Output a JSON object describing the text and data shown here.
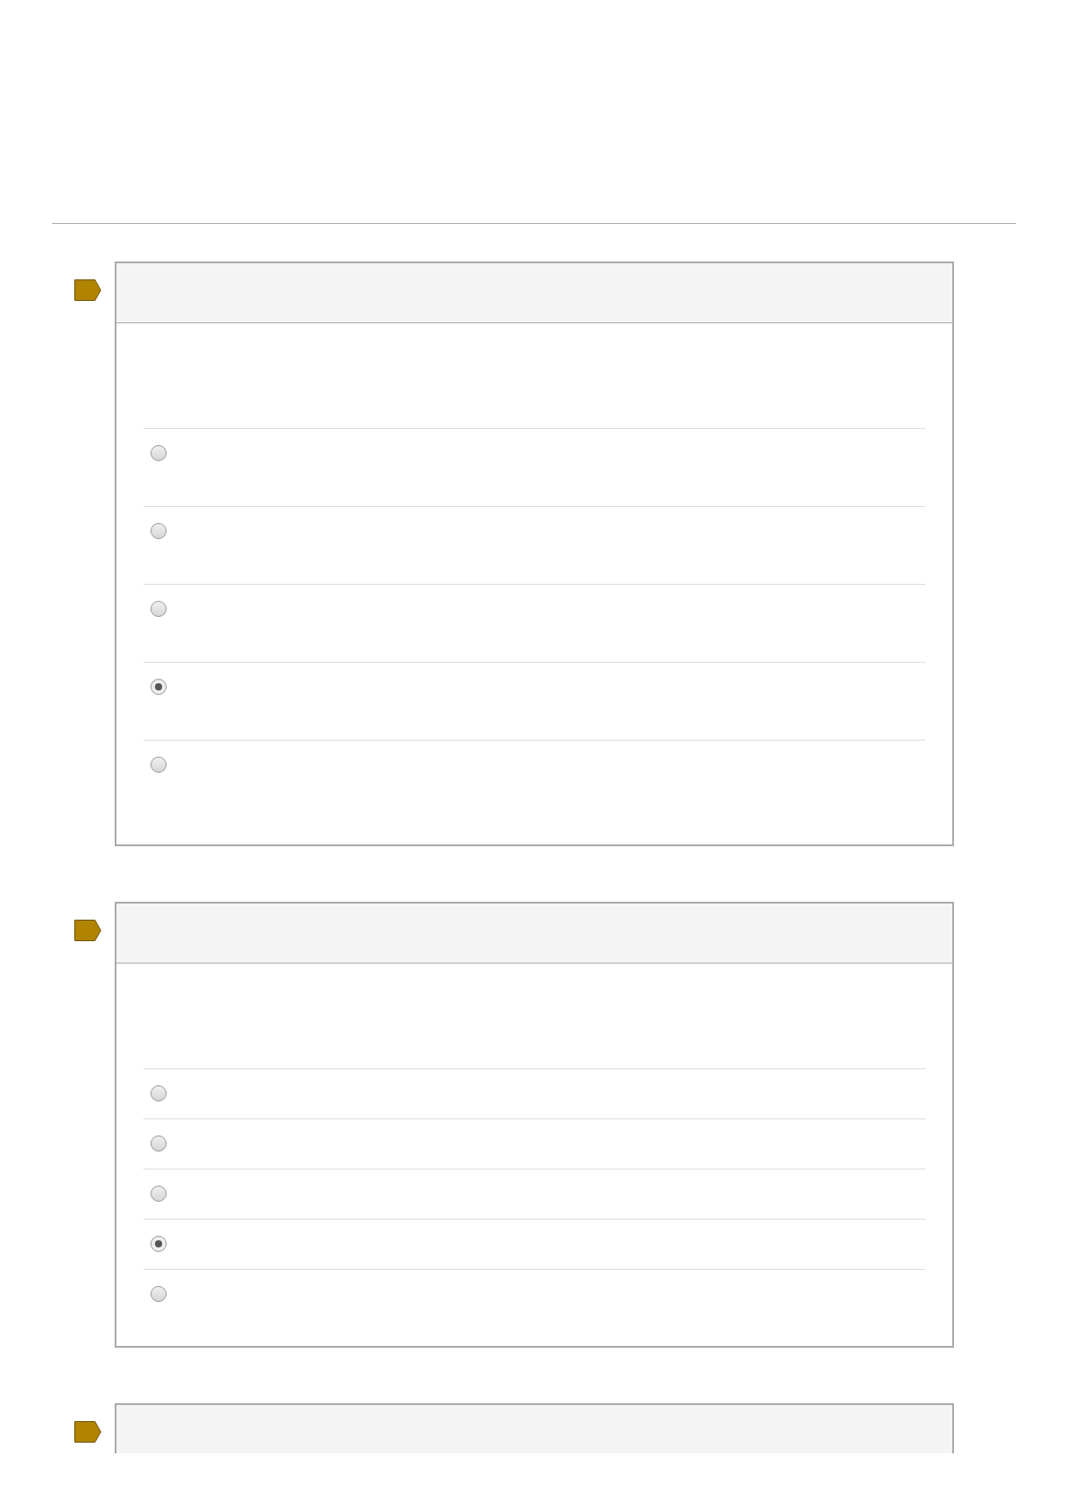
{
  "questions": [
    {
      "options": [
        {
          "selected": false
        },
        {
          "selected": false
        },
        {
          "selected": false
        },
        {
          "selected": true
        },
        {
          "selected": false
        }
      ]
    },
    {
      "options": [
        {
          "selected": false
        },
        {
          "selected": false
        },
        {
          "selected": false
        },
        {
          "selected": true
        },
        {
          "selected": false
        }
      ]
    },
    {
      "cut_off": true
    }
  ]
}
